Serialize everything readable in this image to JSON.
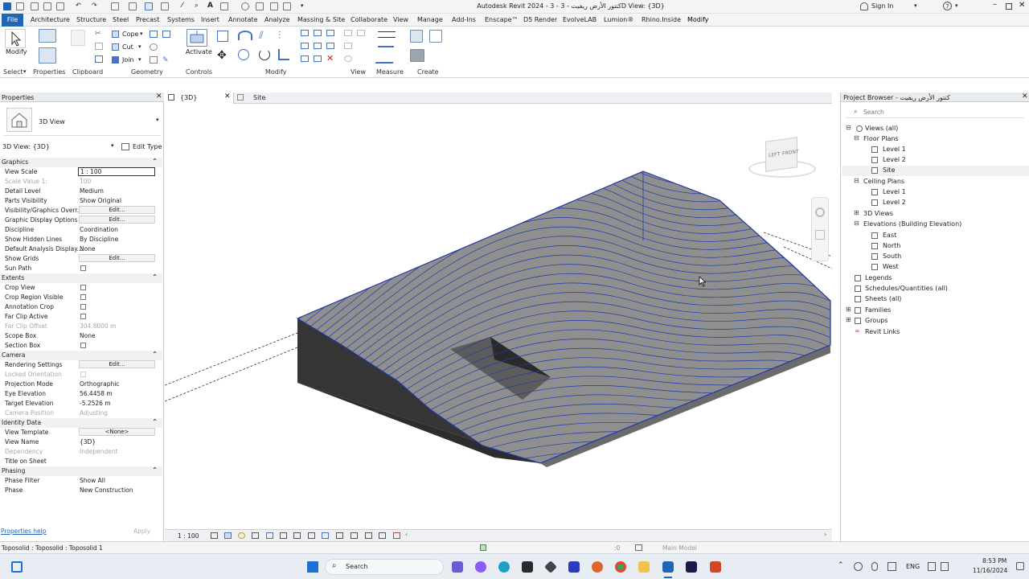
{
  "window": {
    "title": "Autodesk Revit 2024 - كنتور الأرض ريفيت - 3 - 3D View: {3D}",
    "sign_in": "Sign In"
  },
  "menu_tabs": [
    "File",
    "Architecture",
    "Structure",
    "Steel",
    "Precast",
    "Systems",
    "Insert",
    "Annotate",
    "Analyze",
    "Massing & Site",
    "Collaborate",
    "View",
    "Manage",
    "Add-Ins",
    "Enscape™",
    "D5 Render",
    "EvolveLAB",
    "Lumion®",
    "Rhino.Inside",
    "Modify"
  ],
  "ribbon": {
    "modify_label": "Modify",
    "select_label": "Select",
    "properties_label": "Properties",
    "clipboard_label": "Clipboard",
    "geometry_label": "Geometry",
    "controls_label": "Controls",
    "modify_panel_label": "Modify",
    "view_label": "View",
    "measure_label": "Measure",
    "create_label": "Create",
    "cope_label": "Cope",
    "cut_label": "Cut",
    "join_label": "Join",
    "activate_label": "Activate"
  },
  "properties": {
    "title": "Properties",
    "type_name": "3D View",
    "selector_value": "3D View: {3D}",
    "edit_type_label": "Edit Type",
    "sections": {
      "graphics": "Graphics",
      "extents": "Extents",
      "camera": "Camera",
      "identity": "Identity Data",
      "phasing": "Phasing"
    },
    "graphics": {
      "view_scale": {
        "k": "View Scale",
        "v": "1 : 100"
      },
      "scale_value": {
        "k": "Scale Value    1:",
        "v": "100"
      },
      "detail_level": {
        "k": "Detail Level",
        "v": "Medium"
      },
      "parts_visibility": {
        "k": "Parts Visibility",
        "v": "Show Original"
      },
      "vg_overrides": {
        "k": "Visibility/Graphics Overr...",
        "v": "Edit..."
      },
      "graphic_display": {
        "k": "Graphic Display Options",
        "v": "Edit..."
      },
      "discipline": {
        "k": "Discipline",
        "v": "Coordination"
      },
      "hidden_lines": {
        "k": "Show Hidden Lines",
        "v": "By Discipline"
      },
      "analysis_display": {
        "k": "Default Analysis Display...",
        "v": "None"
      },
      "show_grids": {
        "k": "Show Grids",
        "v": "Edit..."
      },
      "sun_path": {
        "k": "Sun Path"
      }
    },
    "extents": {
      "crop_view": {
        "k": "Crop View"
      },
      "crop_region_visible": {
        "k": "Crop Region Visible"
      },
      "annotation_crop": {
        "k": "Annotation Crop"
      },
      "far_clip_active": {
        "k": "Far Clip Active"
      },
      "far_clip_offset": {
        "k": "Far Clip Offset",
        "v": "304.8000 m"
      },
      "scope_box": {
        "k": "Scope Box",
        "v": "None"
      },
      "section_box": {
        "k": "Section Box"
      }
    },
    "camera": {
      "rendering_settings": {
        "k": "Rendering Settings",
        "v": "Edit..."
      },
      "locked_orientation": {
        "k": "Locked Orientation"
      },
      "projection_mode": {
        "k": "Projection Mode",
        "v": "Orthographic"
      },
      "eye_elevation": {
        "k": "Eye Elevation",
        "v": "56.4458 m"
      },
      "target_elevation": {
        "k": "Target Elevation",
        "v": "-5.2526 m"
      },
      "camera_position": {
        "k": "Camera Position",
        "v": "Adjusting"
      }
    },
    "identity": {
      "view_template": {
        "k": "View Template",
        "v": "<None>"
      },
      "view_name": {
        "k": "View Name",
        "v": "{3D}"
      },
      "dependency": {
        "k": "Dependency",
        "v": "Independent"
      },
      "title_on_sheet": {
        "k": "Title on Sheet"
      }
    },
    "phasing": {
      "phase_filter": {
        "k": "Phase Filter",
        "v": "Show All"
      },
      "phase": {
        "k": "Phase",
        "v": "New Construction"
      }
    },
    "help_link": "Properties help",
    "apply_label": "Apply"
  },
  "view_tabs": [
    {
      "label": "{3D}"
    },
    {
      "label": "Site"
    }
  ],
  "view_bar": {
    "scale": "1 : 100"
  },
  "viewcube": {
    "left": "LEFT",
    "front": "FRONT"
  },
  "browser": {
    "title": "Project Browser - كنتور الأرض ريفيت",
    "search_placeholder": "Search",
    "items": {
      "views_all": "Views (all)",
      "floor_plans": "Floor Plans",
      "fp_level1": "Level 1",
      "fp_level2": "Level 2",
      "fp_site": "Site",
      "ceiling_plans": "Ceiling Plans",
      "cp_level1": "Level 1",
      "cp_level2": "Level 2",
      "views_3d": "3D Views",
      "elevations": "Elevations (Building Elevation)",
      "east": "East",
      "north": "North",
      "south": "South",
      "west": "West",
      "legends": "Legends",
      "schedules": "Schedules/Quantities (all)",
      "sheets": "Sheets (all)",
      "families": "Families",
      "groups": "Groups",
      "revit_links": "Revit Links"
    }
  },
  "status": {
    "selection": "Toposolid : Toposolid : Toposolid 1",
    "model": "Main Model",
    "zero": ":0"
  },
  "taskbar": {
    "search_label": "Search",
    "lang": "ENG",
    "time": "8:53 PM",
    "date": "11/16/2024"
  },
  "colors": {
    "accent": "#1f66b5",
    "terrain_top": "#8e8e8e",
    "terrain_side": "#3b3b3b",
    "contour": "#1f3aa6"
  }
}
